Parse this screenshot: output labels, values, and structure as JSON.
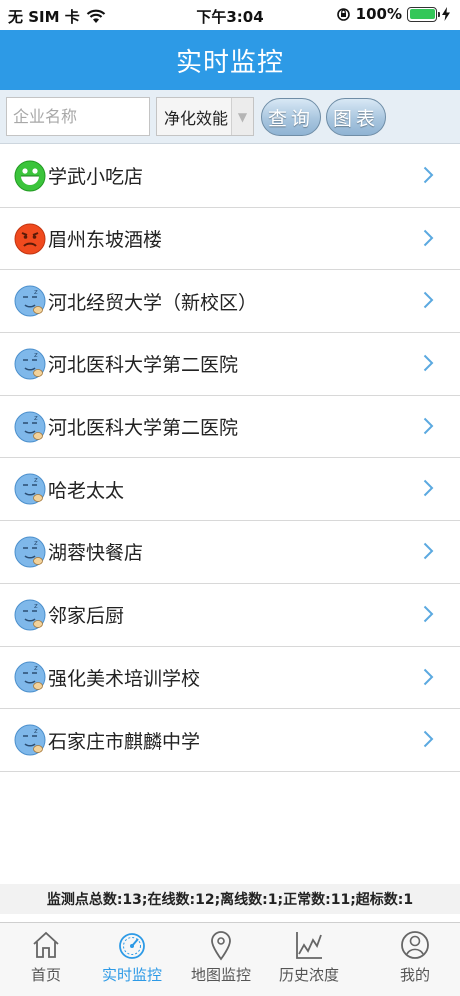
{
  "status": {
    "carrier": "无 SIM 卡",
    "time": "下午3:04",
    "battery": "100%"
  },
  "nav": {
    "title": "实时监控"
  },
  "search": {
    "placeholder": "企业名称",
    "select_value": "净化效能",
    "query_label": "查询",
    "chart_label": "图表"
  },
  "list": [
    {
      "name": "学武小吃店",
      "status": "happy-face"
    },
    {
      "name": "眉州东坡酒楼",
      "status": "sad-face"
    },
    {
      "name": "河北经贸大学（新校区）",
      "status": "sleeping-face"
    },
    {
      "name": "河北医科大学第二医院",
      "status": "sleeping-face"
    },
    {
      "name": "河北医科大学第二医院",
      "status": "sleeping-face"
    },
    {
      "name": "哈老太太",
      "status": "sleeping-face"
    },
    {
      "name": "湖蓉快餐店",
      "status": "sleeping-face"
    },
    {
      "name": "邻家后厨",
      "status": "sleeping-face"
    },
    {
      "name": "强化美术培训学校",
      "status": "sleeping-face"
    },
    {
      "name": "石家庄市麒麟中学",
      "status": "sleeping-face"
    }
  ],
  "summary": "监测点总数:13;在线数:12;离线数:1;正常数:11;超标数:1",
  "tabs": [
    {
      "label": "首页",
      "icon": "home-icon"
    },
    {
      "label": "实时监控",
      "icon": "gauge-icon",
      "active": true
    },
    {
      "label": "地图监控",
      "icon": "map-pin-icon"
    },
    {
      "label": "历史浓度",
      "icon": "line-chart-icon"
    },
    {
      "label": "我的",
      "icon": "user-icon"
    }
  ],
  "colors": {
    "accent": "#2d9ae6",
    "happy": "#3bc43b",
    "sad": "#f04a1e",
    "sleeping": "#7fb8ea"
  }
}
